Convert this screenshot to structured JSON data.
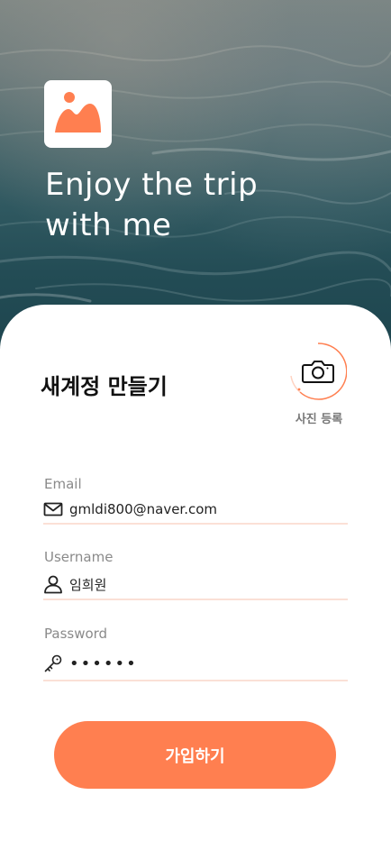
{
  "hero": {
    "title_line1": "Enjoy the trip",
    "title_line2": "with me",
    "logo_icon": "mountain-picture-icon"
  },
  "form": {
    "title": "새계정 만들기",
    "photo_button_icon": "camera-icon",
    "photo_label": "사진 등록",
    "email": {
      "label": "Email",
      "icon": "mail-icon",
      "value": "gmldi800@naver.com"
    },
    "username": {
      "label": "Username",
      "icon": "user-icon",
      "value": "임희원"
    },
    "password": {
      "label": "Password",
      "icon": "key-icon",
      "value": "••••••"
    },
    "submit_label": "가입하기"
  },
  "colors": {
    "accent": "#ff7f50",
    "underline": "#fbe0d6",
    "label": "#8a8a8a",
    "title_text": "#111111",
    "hero_text": "#ffffff"
  }
}
